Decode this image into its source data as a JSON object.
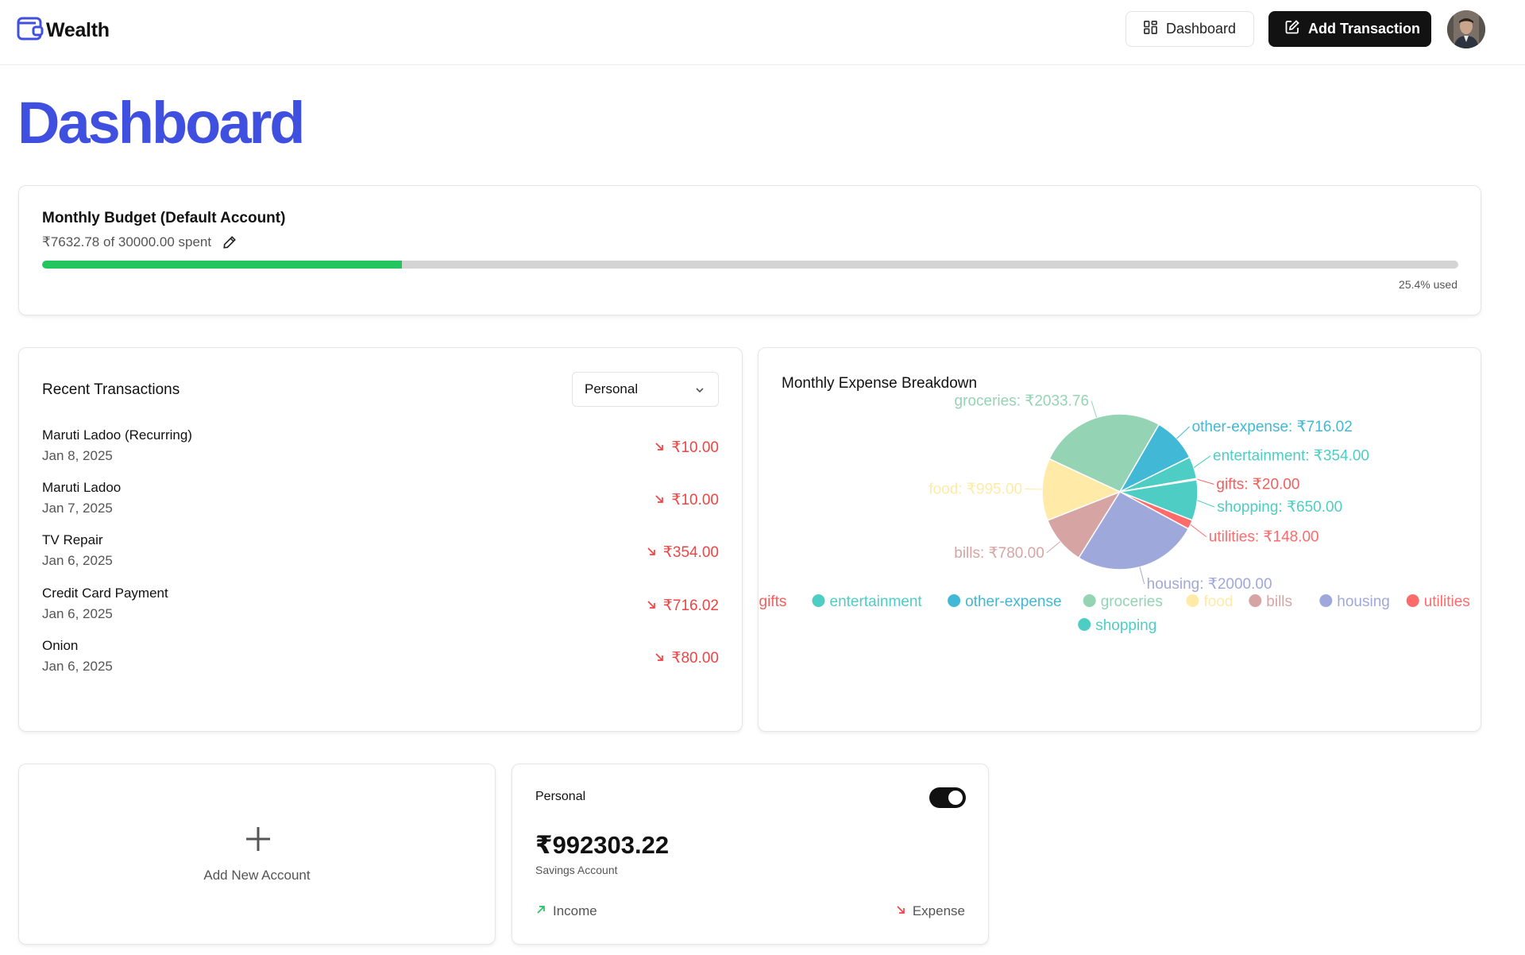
{
  "header": {
    "brand": "Wealth",
    "dashboard_label": "Dashboard",
    "add_transaction_label": "Add Transaction"
  },
  "page": {
    "title": "Dashboard"
  },
  "budget": {
    "title": "Monthly Budget (Default Account)",
    "spent_text": "₹7632.78 of 30000.00 spent",
    "used_fraction": 0.254,
    "used_text": "25.4% used",
    "fill_color": "#22c55e"
  },
  "transactions": {
    "title": "Recent Transactions",
    "account_select": "Personal",
    "items": [
      {
        "name": "Maruti Ladoo (Recurring)",
        "date": "Jan 8, 2025",
        "amount": "₹10.00",
        "type": "expense"
      },
      {
        "name": "Maruti Ladoo",
        "date": "Jan 7, 2025",
        "amount": "₹10.00",
        "type": "expense"
      },
      {
        "name": "TV Repair",
        "date": "Jan 6, 2025",
        "amount": "₹354.00",
        "type": "expense"
      },
      {
        "name": "Credit Card Payment",
        "date": "Jan 6, 2025",
        "amount": "₹716.02",
        "type": "expense"
      },
      {
        "name": "Onion",
        "date": "Jan 6, 2025",
        "amount": "₹80.00",
        "type": "expense"
      }
    ],
    "expense_color": "#ef4444"
  },
  "breakdown": {
    "title": "Monthly Expense Breakdown"
  },
  "chart_data": {
    "type": "pie",
    "title": "Monthly Expense Breakdown",
    "slices": [
      {
        "name": "groceries",
        "value": 2033.76,
        "label": "groceries: ₹2033.76",
        "color": "#94d3b4"
      },
      {
        "name": "other-expense",
        "value": 716.02,
        "label": "other-expense: ₹716.02",
        "color": "#41b8d5"
      },
      {
        "name": "entertainment",
        "value": 354.0,
        "label": "entertainment: ₹354.00",
        "color": "#4ecdc4"
      },
      {
        "name": "gifts",
        "value": 20.0,
        "label": "gifts: ₹20.00",
        "color": "#f25f5c"
      },
      {
        "name": "shopping",
        "value": 650.0,
        "label": "shopping: ₹650.00",
        "color": "#4ecdc4"
      },
      {
        "name": "utilities",
        "value": 148.0,
        "label": "utilities: ₹148.00",
        "color": "#ff6b6b"
      },
      {
        "name": "housing",
        "value": 2000.0,
        "label": "housing: ₹2000.00",
        "color": "#9fa8da"
      },
      {
        "name": "bills",
        "value": 780.0,
        "label": "bills: ₹780.00",
        "color": "#d7a4a4"
      },
      {
        "name": "food",
        "value": 995.0,
        "label": "food: ₹995.00",
        "color": "#ffeaa7"
      }
    ],
    "legend": [
      {
        "name": "gifts",
        "color": "#f25f5c"
      },
      {
        "name": "entertainment",
        "color": "#4ecdc4"
      },
      {
        "name": "other-expense",
        "color": "#41b8d5"
      },
      {
        "name": "groceries",
        "color": "#94d3b4"
      },
      {
        "name": "food",
        "color": "#ffeaa7"
      },
      {
        "name": "bills",
        "color": "#d7a4a4"
      },
      {
        "name": "housing",
        "color": "#9fa8da"
      },
      {
        "name": "utilities",
        "color": "#ff6b6b"
      },
      {
        "name": "shopping",
        "color": "#4ecdc4"
      }
    ],
    "legend_position": "bottom"
  },
  "accounts": {
    "add_label": "Add New Account",
    "items": [
      {
        "name": "Personal",
        "balance": "₹992303.22",
        "type": "Savings Account",
        "default_enabled": true,
        "income_label": "Income",
        "expense_label": "Expense"
      }
    ]
  }
}
